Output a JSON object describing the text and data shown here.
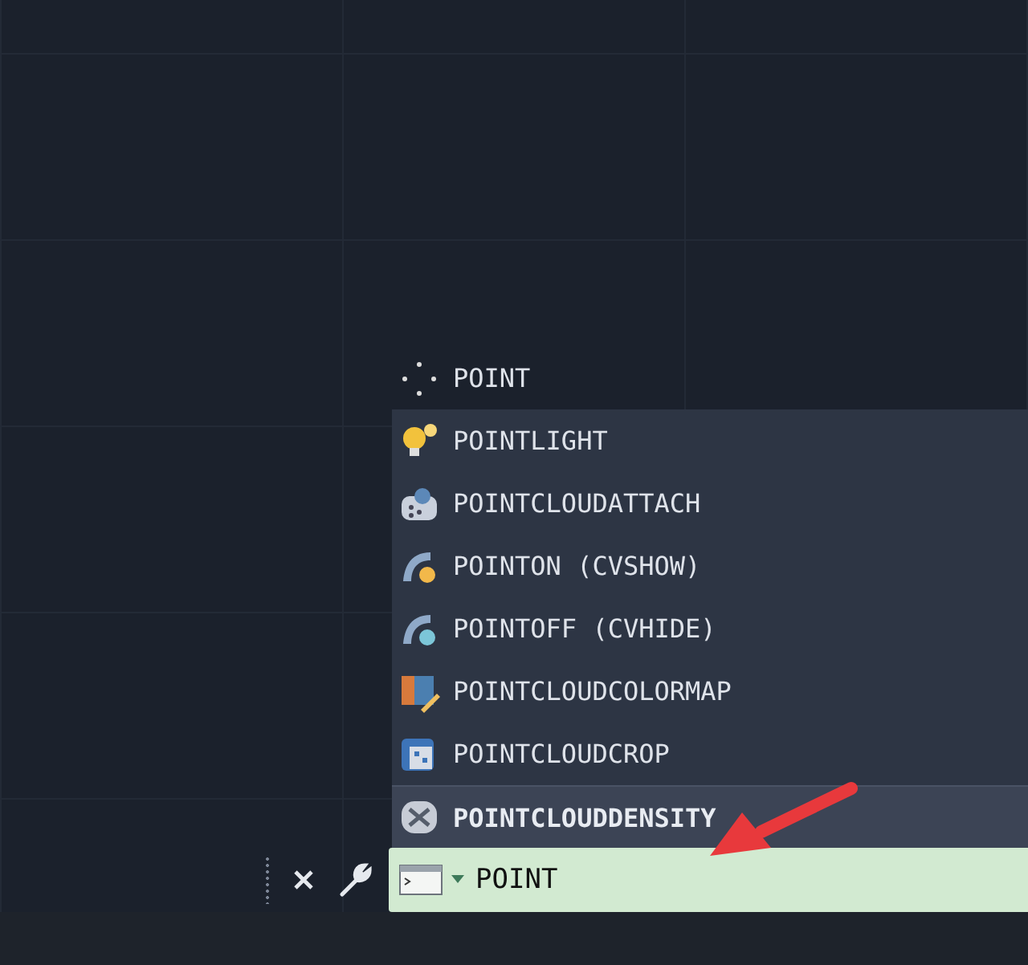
{
  "autocomplete": {
    "top_match": {
      "label": "POINT"
    },
    "suggestions": [
      {
        "label": "POINTLIGHT",
        "selected": false
      },
      {
        "label": "POINTCLOUDATTACH",
        "selected": false
      },
      {
        "label": "POINTON (CVSHOW)",
        "selected": false
      },
      {
        "label": "POINTOFF (CVHIDE)",
        "selected": false
      },
      {
        "label": "POINTCLOUDCOLORMAP",
        "selected": false
      },
      {
        "label": "POINTCLOUDCROP",
        "selected": false
      },
      {
        "label": "POINTCLOUDDENSITY",
        "selected": true
      }
    ]
  },
  "command_line": {
    "value": "POINT"
  }
}
